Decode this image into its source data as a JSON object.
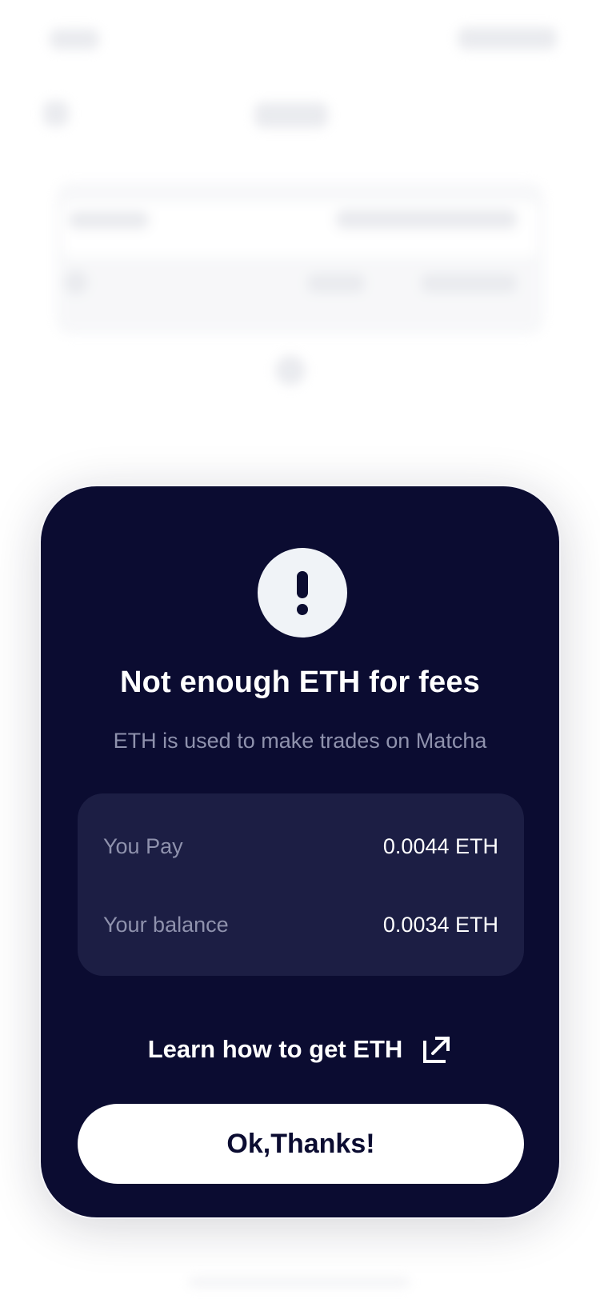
{
  "colors": {
    "modal_background": "#0b0c31",
    "panel_background": "#1c1e44",
    "muted_text": "#8f92ad",
    "button_background": "#ffffff",
    "button_text": "#0b0c31",
    "alert_circle": "#f0f3f7"
  },
  "modal": {
    "icon": "exclamation-icon",
    "title": "Not enough ETH for fees",
    "subtitle": "ETH is used to make trades on Matcha",
    "details": [
      {
        "label": "You Pay",
        "value": "0.0044 ETH"
      },
      {
        "label": "Your balance",
        "value": "0.0034 ETH"
      }
    ],
    "learn_link": {
      "text": "Learn how to get ETH",
      "icon": "external-link-icon"
    },
    "confirm_button": "Ok,Thanks!"
  }
}
